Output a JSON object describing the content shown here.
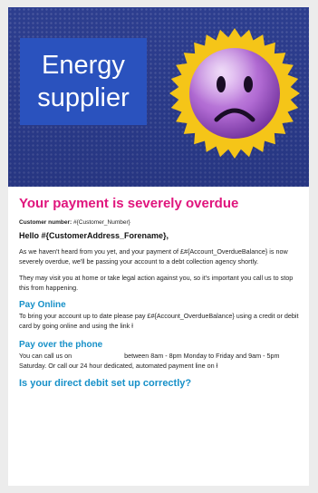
{
  "hero": {
    "label_line1": "Energy",
    "label_line2": "supplier",
    "badge_icon": "sad-face-icon",
    "colors": {
      "hero_bg": "#2d3e8f",
      "label_bg": "#2a52be",
      "badge_burst": "#f5c518",
      "face": "#b06ad2"
    }
  },
  "email": {
    "headline": "Your payment is severely overdue",
    "customer_number_label": "Customer number:",
    "customer_number_value": "#{Customer_Number}",
    "greeting": "Hello #{CustomerAddress_Forename},",
    "paragraph1": "As we haven't heard from you yet, and your payment of £#{Account_OverdueBalance} is now severely overdue, we'll be passing your account to a debt collection agency shortly.",
    "paragraph2": "They may visit you at home or take legal action against you, so it's important you call us to stop this from happening.",
    "sections": [
      {
        "heading": "Pay Online",
        "body": "To bring your account up to date please pay £#{Account_OverdueBalance} using a credit or debit card by going online and using the link ł"
      },
      {
        "heading": "Pay over the phone",
        "body_part1": "You can call us on",
        "body_part2": "between 8am - 8pm Monday to Friday and 9am - 5pm Saturday. Or call our 24 hour dedicated, automated payment line on ł"
      }
    ],
    "footer_heading": "Is your direct debit set up correctly?",
    "colors": {
      "headline": "#e0157d",
      "subheading": "#1690c8"
    }
  }
}
